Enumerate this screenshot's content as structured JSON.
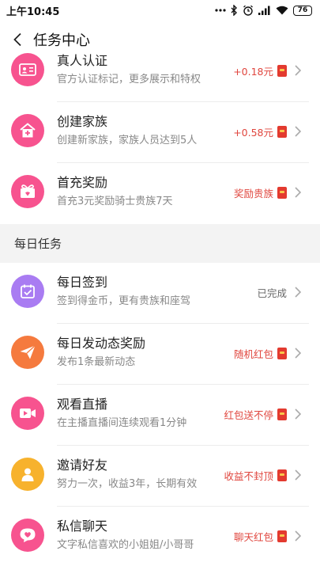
{
  "status_bar": {
    "time": "上午10:45",
    "battery": "76"
  },
  "nav": {
    "title": "任务中心"
  },
  "colors": {
    "reward": "#e0463e",
    "pink": "#f7538f",
    "orange": "#f57a3e",
    "purple": "#a97cf2",
    "yellow": "#f7b22d"
  },
  "top_tasks": [
    {
      "title": "真人认证",
      "desc": "官方认证标记，更多展示和特权",
      "reward": "+0.18元",
      "icon": "id-card-icon"
    },
    {
      "title": "创建家族",
      "desc": "创建新家族，家族人员达到5人",
      "reward": "+0.58元",
      "icon": "house-icon"
    },
    {
      "title": "首充奖励",
      "desc": "首充3元奖励骑士贵族7天",
      "reward": "奖励贵族",
      "icon": "gift-icon"
    }
  ],
  "daily_section": {
    "title": "每日任务"
  },
  "daily_tasks": [
    {
      "title": "每日签到",
      "desc": "签到得金币，更有贵族和座驾",
      "reward": "已完成",
      "icon": "calendar-check-icon"
    },
    {
      "title": "每日发动态奖励",
      "desc": "发布1条最新动态",
      "reward": "随机红包",
      "icon": "paper-plane-icon"
    },
    {
      "title": "观看直播",
      "desc": "在主播直播间连续观看1分钟",
      "reward": "红包送不停",
      "icon": "video-icon"
    },
    {
      "title": "邀请好友",
      "desc": "努力一次，收益3年，长期有效",
      "reward": "收益不封顶",
      "icon": "user-icon"
    },
    {
      "title": "私信聊天",
      "desc": "文字私信喜欢的小姐姐/小哥哥",
      "reward": "聊天红包",
      "icon": "chat-heart-icon"
    }
  ]
}
